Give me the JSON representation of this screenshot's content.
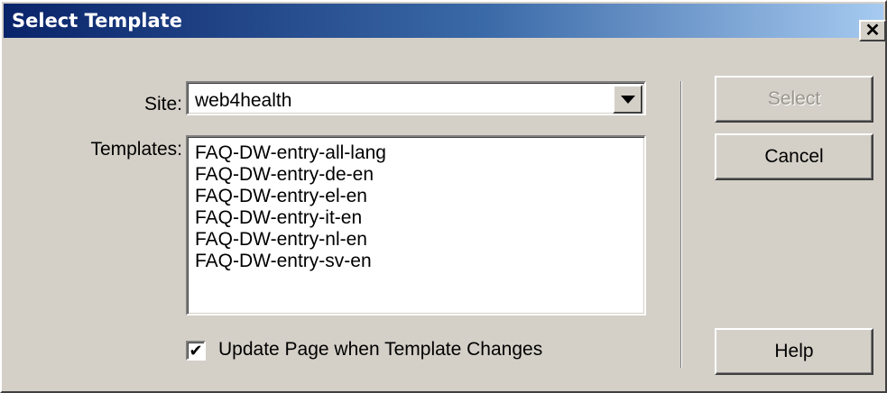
{
  "window": {
    "title": "Select Template",
    "close_label": "✕"
  },
  "form": {
    "site_label": "Site:",
    "site_value": "web4health",
    "templates_label": "Templates:",
    "templates": [
      "FAQ-DW-entry-all-lang",
      "FAQ-DW-entry-de-en",
      "FAQ-DW-entry-el-en",
      "FAQ-DW-entry-it-en",
      "FAQ-DW-entry-nl-en",
      "FAQ-DW-entry-sv-en"
    ],
    "update_checkbox_label": "Update Page when Template Changes",
    "update_checked": true
  },
  "buttons": {
    "select": "Select",
    "cancel": "Cancel",
    "help": "Help"
  },
  "colors": {
    "dialog_bg": "#d4d0c8",
    "title_start": "#0a246a",
    "title_end": "#a6caf0"
  }
}
